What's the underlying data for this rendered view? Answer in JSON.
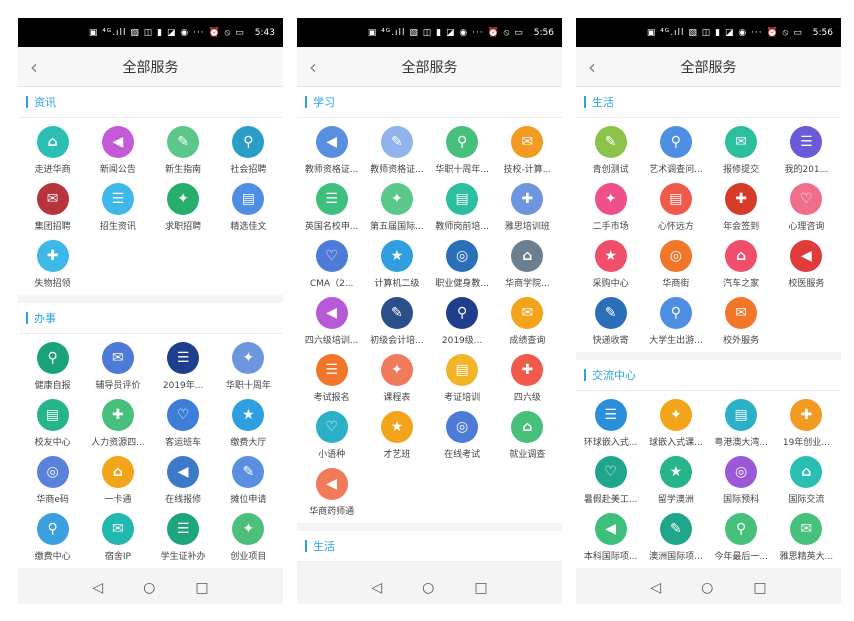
{
  "screens": [
    {
      "status_time": "5:43",
      "title": "全部服务",
      "sections": [
        {
          "name": "资讯",
          "items": [
            {
              "label": "走进华商",
              "color": "#2bbfb3"
            },
            {
              "label": "新闻公告",
              "color": "#c55ad8"
            },
            {
              "label": "新生指南",
              "color": "#5cc78a"
            },
            {
              "label": "社会招聘",
              "color": "#2b9ec6"
            },
            {
              "label": "集团招聘",
              "color": "#b8333c"
            },
            {
              "label": "招生资讯",
              "color": "#3db8e8"
            },
            {
              "label": "求职招聘",
              "color": "#27ae6a"
            },
            {
              "label": "精选佳文",
              "color": "#4f8fe3"
            },
            {
              "label": "失物招领",
              "color": "#3db8e8"
            }
          ]
        },
        {
          "name": "办事",
          "items": [
            {
              "label": "健康自报",
              "color": "#1aa37a"
            },
            {
              "label": "辅导员评价",
              "color": "#4f7bd8"
            },
            {
              "label": "2019年...",
              "color": "#1f3e8c"
            },
            {
              "label": "华职十周年",
              "color": "#6e96de"
            },
            {
              "label": "校友中心",
              "color": "#26b58a"
            },
            {
              "label": "人力资源四...",
              "color": "#46c07a"
            },
            {
              "label": "客运班车",
              "color": "#3e7ed8"
            },
            {
              "label": "缴费大厅",
              "color": "#2f9fe0"
            },
            {
              "label": "华商e码",
              "color": "#5a82d8"
            },
            {
              "label": "一卡通",
              "color": "#f2a51a"
            },
            {
              "label": "在线报修",
              "color": "#3e78c8"
            },
            {
              "label": "摊位申请",
              "color": "#5a8ee0"
            },
            {
              "label": "缴费中心",
              "color": "#3aa0e0"
            },
            {
              "label": "宿舍IP",
              "color": "#21b9ae"
            },
            {
              "label": "学生证补办",
              "color": "#1ea57e"
            },
            {
              "label": "创业项目",
              "color": "#4cc07a"
            }
          ]
        }
      ]
    },
    {
      "status_time": "5:56",
      "title": "全部服务",
      "sections": [
        {
          "name": "学习",
          "items": [
            {
              "label": "教师资格证...",
              "color": "#5a8ee0"
            },
            {
              "label": "教师资格证...",
              "color": "#8fb3ea"
            },
            {
              "label": "华职十周年...",
              "color": "#46c07a"
            },
            {
              "label": "技校-计算...",
              "color": "#f29a22"
            },
            {
              "label": "英国名校申...",
              "color": "#3cc07c"
            },
            {
              "label": "第五届国际...",
              "color": "#5cc78a"
            },
            {
              "label": "教师岗前培...",
              "color": "#2bbfa0"
            },
            {
              "label": "雅思培训班",
              "color": "#6e96de"
            },
            {
              "label": "CMA（2...",
              "color": "#4f7bd8"
            },
            {
              "label": "计算机二级",
              "color": "#2f9fe0"
            },
            {
              "label": "职业健身教...",
              "color": "#2b6fb8"
            },
            {
              "label": "华商学院...",
              "color": "#6a7f8f"
            },
            {
              "label": "四六级培训...",
              "color": "#b65ad8"
            },
            {
              "label": "初级会计培...",
              "color": "#2a4f8a"
            },
            {
              "label": "2019级...",
              "color": "#1f3e8c"
            },
            {
              "label": "成绩查询",
              "color": "#f2a51a"
            },
            {
              "label": "考试报名",
              "color": "#f2762a"
            },
            {
              "label": "课程表",
              "color": "#f07a5a"
            },
            {
              "label": "考证培训",
              "color": "#f2b52a"
            },
            {
              "label": "四六级",
              "color": "#f05a4a"
            },
            {
              "label": "小语种",
              "color": "#2bb0c8"
            },
            {
              "label": "才艺班",
              "color": "#f2a51a"
            },
            {
              "label": "在线考试",
              "color": "#4f7bd8"
            },
            {
              "label": "就业调查",
              "color": "#46c07a"
            },
            {
              "label": "华商药师通",
              "color": "#f07a5a"
            }
          ]
        },
        {
          "name": "生活",
          "items": []
        }
      ]
    },
    {
      "status_time": "5:56",
      "title": "全部服务",
      "sections": [
        {
          "name": "生活",
          "items": [
            {
              "label": "青创测试",
              "color": "#8bc34a"
            },
            {
              "label": "艺术调查问...",
              "color": "#4f8fe3"
            },
            {
              "label": "报修提交",
              "color": "#2bbf9e"
            },
            {
              "label": "我的201...",
              "color": "#6a5ad8"
            },
            {
              "label": "二手市场",
              "color": "#ef4f8a"
            },
            {
              "label": "心怀远方",
              "color": "#f05a4a"
            },
            {
              "label": "年会签到",
              "color": "#d83a2a"
            },
            {
              "label": "心理咨询",
              "color": "#ef6f8a"
            },
            {
              "label": "采购中心",
              "color": "#ef4f6a"
            },
            {
              "label": "华商街",
              "color": "#f2762a"
            },
            {
              "label": "汽车之家",
              "color": "#ef4f6a"
            },
            {
              "label": "校医服务",
              "color": "#e03a3a"
            },
            {
              "label": "快递收寄",
              "color": "#2a6fb8"
            },
            {
              "label": "大学生出游...",
              "color": "#4f8fe3"
            },
            {
              "label": "校外服务",
              "color": "#f2762a"
            }
          ]
        },
        {
          "name": "交流中心",
          "items": [
            {
              "label": "环球嵌入式...",
              "color": "#2a8fd8"
            },
            {
              "label": "球嵌入式课...",
              "color": "#f2a51a"
            },
            {
              "label": "粤港澳大湾...",
              "color": "#2bb0c8"
            },
            {
              "label": "19年创业...",
              "color": "#f29a22"
            },
            {
              "label": "暑假赴美工...",
              "color": "#1ea58a"
            },
            {
              "label": "留学澳洲",
              "color": "#26b58a"
            },
            {
              "label": "国际预科",
              "color": "#9a5ad8"
            },
            {
              "label": "国际交流",
              "color": "#2bbfb3"
            },
            {
              "label": "本科国际项...",
              "color": "#3cc07c"
            },
            {
              "label": "澳洲国际项...",
              "color": "#1ea58a"
            },
            {
              "label": "今年最后一...",
              "color": "#46c07a"
            },
            {
              "label": "雅思精英大...",
              "color": "#46c07a"
            }
          ]
        }
      ]
    }
  ],
  "glyphs": [
    "⌂",
    "◀",
    "✎",
    "⚲",
    "✉",
    "☰",
    "✦",
    "▤",
    "✚",
    "♡",
    "★",
    "◎"
  ],
  "nav": {
    "back": "◁",
    "home": "○",
    "recent": "□"
  },
  "status_icons": "▣ ⁴ᴳ.ıll ▧ ◫ ▮ ◪ ◉ ···   ⏰ ⦸ ▭"
}
